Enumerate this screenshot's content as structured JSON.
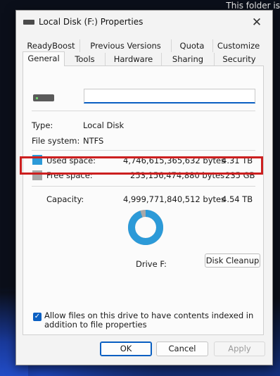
{
  "background": {
    "text": "This folder is"
  },
  "window": {
    "title": "Local Disk (F:) Properties",
    "close_glyph": "✕"
  },
  "tabs": {
    "row1": [
      "ReadyBoost",
      "Previous Versions",
      "Quota",
      "Customize"
    ],
    "row2": [
      "General",
      "Tools",
      "Hardware",
      "Sharing",
      "Security"
    ],
    "selected": "General"
  },
  "general": {
    "volume_name": "",
    "type_label": "Type:",
    "type_value": "Local Disk",
    "fs_label": "File system:",
    "fs_value": "NTFS",
    "used_label": "Used space:",
    "used_bytes": "4,746,615,365,632 bytes",
    "used_size": "4.31 TB",
    "free_label": "Free space:",
    "free_bytes": "253,156,474,880 bytes",
    "free_size": "235 GB",
    "capacity_label": "Capacity:",
    "capacity_bytes": "4,999,771,840,512 bytes",
    "capacity_size": "4.54 TB",
    "drive_label": "Drive F:",
    "cleanup_button": "Disk Cleanup",
    "index_checkbox_label": "Allow files on this drive to have contents indexed in addition to file properties",
    "index_checked": true,
    "used_fraction": 0.949
  },
  "colors": {
    "used": "#2c9ad8",
    "free": "#a8a8a8",
    "highlight": "#cc1f1f",
    "accent": "#0a5fc2"
  },
  "buttons": {
    "ok": "OK",
    "cancel": "Cancel",
    "apply": "Apply"
  }
}
